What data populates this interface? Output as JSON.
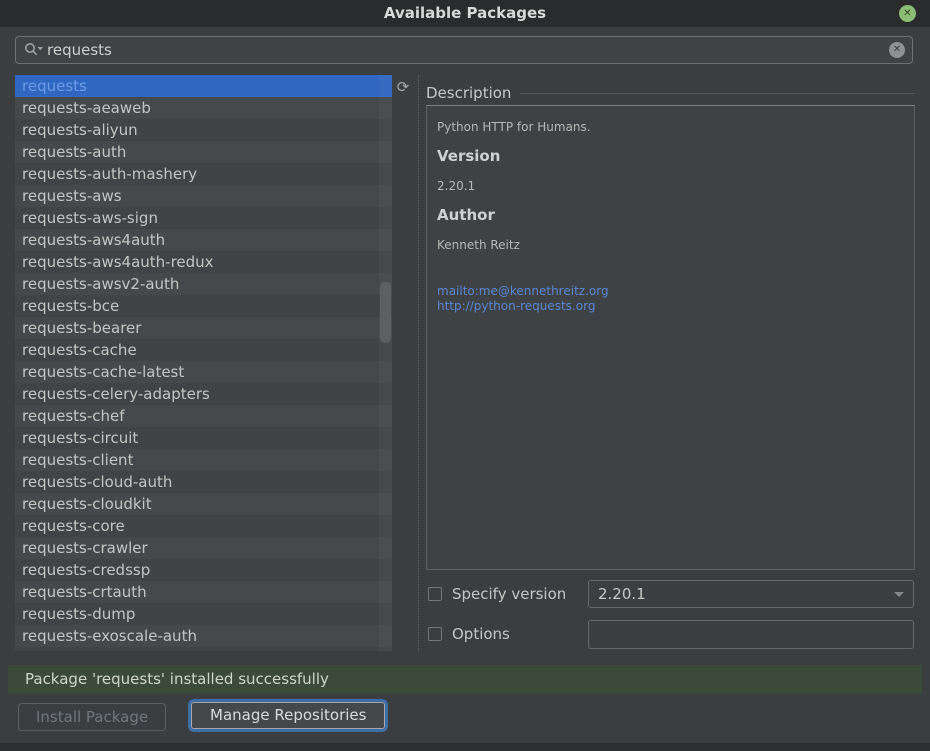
{
  "window": {
    "title": "Available Packages",
    "close_glyph": "✕"
  },
  "search": {
    "value": "requests",
    "clear_glyph": "✕"
  },
  "package_list": {
    "selected_index": 0,
    "items": [
      "requests",
      "requests-aeaweb",
      "requests-aliyun",
      "requests-auth",
      "requests-auth-mashery",
      "requests-aws",
      "requests-aws-sign",
      "requests-aws4auth",
      "requests-aws4auth-redux",
      "requests-awsv2-auth",
      "requests-bce",
      "requests-bearer",
      "requests-cache",
      "requests-cache-latest",
      "requests-celery-adapters",
      "requests-chef",
      "requests-circuit",
      "requests-client",
      "requests-cloud-auth",
      "requests-cloudkit",
      "requests-core",
      "requests-crawler",
      "requests-credssp",
      "requests-crtauth",
      "requests-dump",
      "requests-exoscale-auth"
    ]
  },
  "toolbar": {
    "refresh_glyph": "⟳"
  },
  "description": {
    "header": "Description",
    "summary": "Python HTTP for Humans.",
    "version_label": "Version",
    "version": "2.20.1",
    "author_label": "Author",
    "author": "Kenneth Reitz",
    "links": [
      "mailto:me@kennethreitz.org",
      "http://python-requests.org"
    ]
  },
  "controls": {
    "specify_version": {
      "label": "Specify version",
      "checked": false,
      "value": "2.20.1"
    },
    "options": {
      "label": "Options",
      "checked": false,
      "value": ""
    }
  },
  "status": {
    "message": "Package 'requests' installed successfully"
  },
  "buttons": {
    "install": {
      "label": "Install Package",
      "enabled": false
    },
    "manage": {
      "label": "Manage Repositories",
      "focused": true
    }
  },
  "colors": {
    "selection_bg": "#3067c1",
    "selection_text": "#6d9ce6",
    "link": "#5b87d2",
    "status_bg": "#3c4a3a",
    "close_button": "#8cbd74"
  }
}
